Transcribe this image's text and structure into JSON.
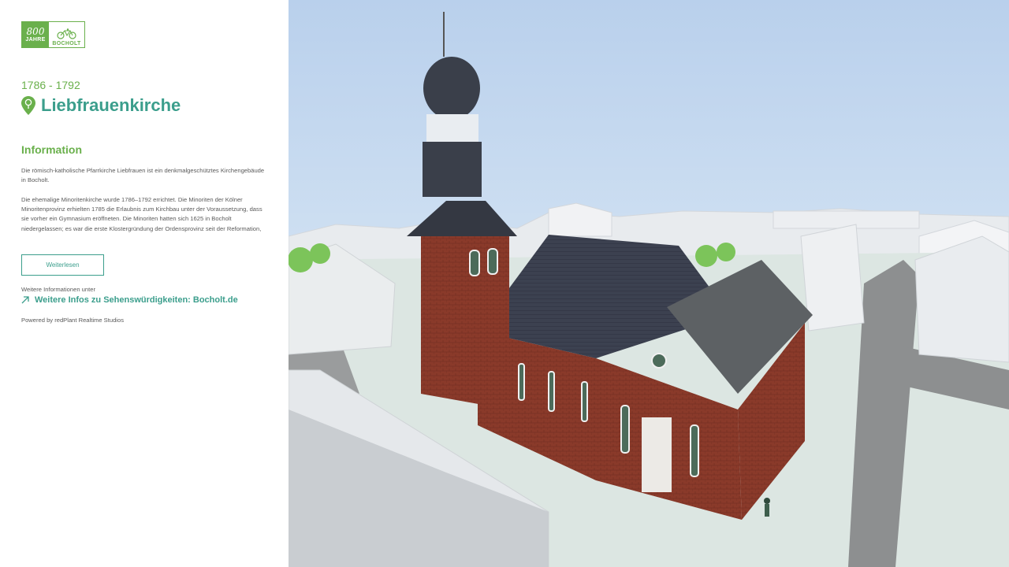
{
  "logo": {
    "number": "800",
    "jahre": "JAHRE",
    "city": "BOCHOLT",
    "brand_color": "#6ab04c"
  },
  "sight": {
    "years": "1786 - 1792",
    "title": "Liebfrauenkirche",
    "pin_icon": "map-pin-tree-icon"
  },
  "info": {
    "heading": "Information",
    "paragraph1": "Die römisch-katholische Pfarrkirche Liebfrauen ist ein denkmalgeschütztes Kirchengebäude in Bocholt.",
    "paragraph2": "Die ehemalige Minoritenkirche wurde 1786–1792 errichtet. Die Minoriten der Kölner Minoritenprovinz erhielten 1785 die Erlaubnis zum Kirchbau unter der Voraussetzung, dass sie vorher ein Gymnasium eröffneten. Die Minoriten hatten sich 1625 in Bocholt niedergelassen; es war die erste Klostergründung der Ordensprovinz seit der Reformation,",
    "read_more_label": "Weiterlesen"
  },
  "more": {
    "prefix": "Weitere Informationen unter",
    "link_label": "Weitere Infos zu Sehenswürdigkeiten: Bocholt.de",
    "link_icon": "external-arrow-icon"
  },
  "footer": {
    "powered_by": "Powered by redPlant Realtime Studios"
  },
  "colors": {
    "accent_green": "#6ab04c",
    "accent_teal": "#3b9e8c",
    "body_text": "#5a5a5a"
  }
}
